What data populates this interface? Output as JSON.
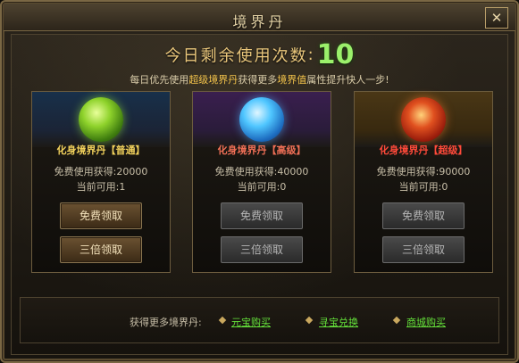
{
  "window": {
    "title": "境界丹",
    "close_label": "✕"
  },
  "usage": {
    "label": "今日剩余使用次数",
    "separator": ":",
    "remaining": "10"
  },
  "hint": {
    "p1": "每日优先使用",
    "hl1": "超级境界丹",
    "p2": "获得更多",
    "hl2": "境界值",
    "p3": "属性提升快人一步!"
  },
  "cards": [
    {
      "name": "化身境界丹【普通】",
      "gain_label": "免费使用获得:",
      "gain_value": "20000",
      "available_label": "当前可用:",
      "available_value": "1",
      "free_button": "免费领取",
      "triple_button": "三倍领取",
      "enabled": true
    },
    {
      "name": "化身境界丹【高级】",
      "gain_label": "免费使用获得:",
      "gain_value": "40000",
      "available_label": "当前可用:",
      "available_value": "0",
      "free_button": "免费领取",
      "triple_button": "三倍领取",
      "enabled": false
    },
    {
      "name": "化身境界丹【超级】",
      "gain_label": "免费使用获得:",
      "gain_value": "90000",
      "available_label": "当前可用:",
      "available_value": "0",
      "free_button": "免费领取",
      "triple_button": "三倍领取",
      "enabled": false
    }
  ],
  "footer": {
    "label": "获得更多境界丹:",
    "links": [
      "元宝购买",
      "寻宝兑换",
      "商城购买"
    ]
  },
  "colors": {
    "accent_gold": "#e9c67b",
    "count_green": "#9bf06b",
    "link_green": "#64e03a"
  }
}
